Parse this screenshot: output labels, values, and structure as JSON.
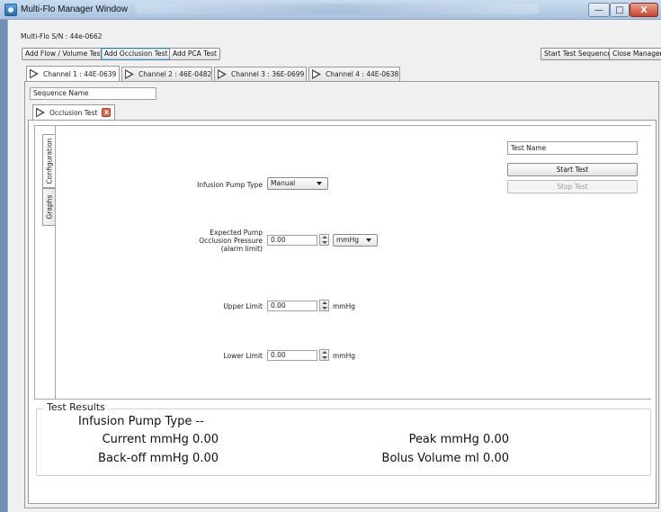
{
  "window": {
    "title": "Multi-Flo Manager Window",
    "controls": {
      "minimize": "—",
      "maximize": "□",
      "close": "X"
    }
  },
  "serial": "Multi-Flo S/N :  44e-0662",
  "toolbar": {
    "add_flow": "Add Flow / Volume Test",
    "add_occlusion": "Add Occlusion Test",
    "add_pca": "Add PCA Test",
    "start_sequence": "Start Test Sequence",
    "close_manager": "Close Manager"
  },
  "channel_tabs": [
    {
      "label": "Channel 1 : 44E-0639"
    },
    {
      "label": "Channel 2 : 46E-0482"
    },
    {
      "label": "Channel 3 : 36E-0699"
    },
    {
      "label": "Channel 4 : 44E-0638"
    }
  ],
  "sequence_name_placeholder": "Sequence Name",
  "test_tab": {
    "label": "Occlusion Test",
    "close": "x"
  },
  "side_tabs": {
    "configuration": "Configuration",
    "graphs": "Graphs"
  },
  "config": {
    "pump_type_label": "Infusion Pump Type",
    "pump_type_value": "Manual",
    "pressure_label_1": "Expected Pump",
    "pressure_label_2": "Occlusion Pressure",
    "pressure_label_3": "(alarm limit)",
    "pressure_value": "0.00",
    "pressure_unit": "mmHg",
    "upper_label": "Upper Limit",
    "upper_value": "0.00",
    "upper_unit": "mmHg",
    "lower_label": "Lower Limit",
    "lower_value": "0.00",
    "lower_unit": "mmHg"
  },
  "right_panel": {
    "test_name_placeholder": "Test Name",
    "start_test": "Start Test",
    "stop_test": "Stop Test"
  },
  "results": {
    "title": "Test Results",
    "pump_type": "Infusion Pump Type --",
    "current": "Current mmHg 0.00",
    "peak": "Peak mmHg 0.00",
    "backoff": "Back-off mmHg 0.00",
    "bolus": "Bolus Volume ml 0.00"
  }
}
